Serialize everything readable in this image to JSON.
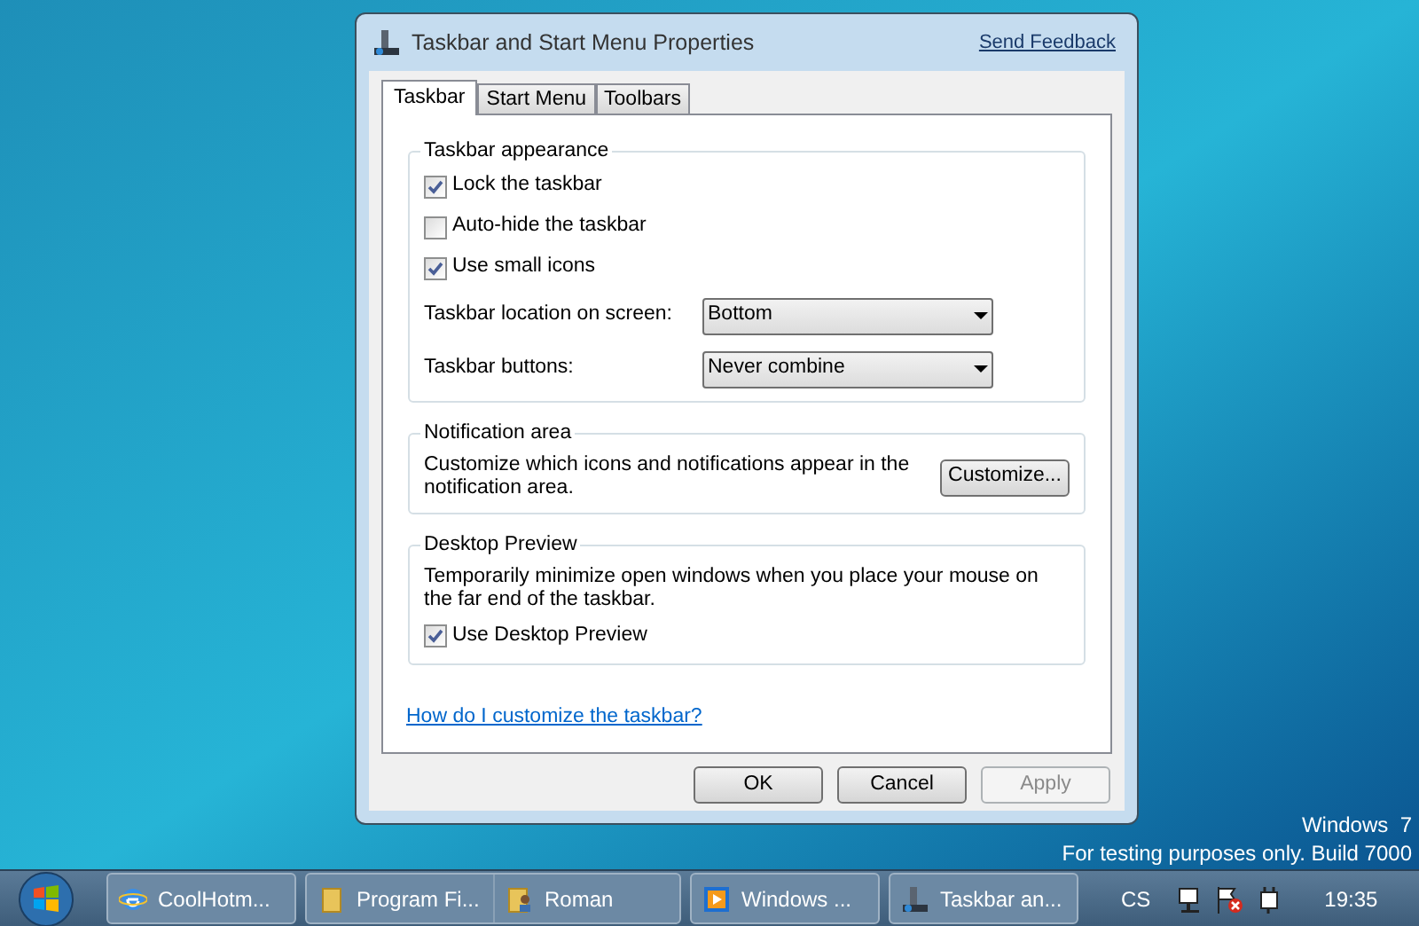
{
  "dialog": {
    "title": "Taskbar and Start Menu Properties",
    "feedback_link": "Send Feedback",
    "tabs": [
      {
        "label": "Taskbar",
        "selected": true
      },
      {
        "label": "Start Menu",
        "selected": false
      },
      {
        "label": "Toolbars",
        "selected": false
      }
    ],
    "appearance": {
      "title": "Taskbar appearance",
      "checkboxes": [
        {
          "label": "Lock the taskbar",
          "checked": true
        },
        {
          "label": "Auto-hide the taskbar",
          "checked": false
        },
        {
          "label": "Use small icons",
          "checked": true
        }
      ],
      "dropdowns": [
        {
          "label": "Taskbar location on screen:",
          "value": "Bottom"
        },
        {
          "label": "Taskbar buttons:",
          "value": "Never combine"
        }
      ]
    },
    "notification": {
      "title": "Notification area",
      "text": "Customize which icons and notifications appear in the notification area.",
      "button": "Customize..."
    },
    "preview": {
      "title": "Desktop Preview",
      "text": "Temporarily minimize open windows when you place your mouse on the far end of the taskbar.",
      "checkbox": {
        "label": "Use Desktop Preview",
        "checked": true
      }
    },
    "help_link": "How do I customize the taskbar?",
    "buttons": [
      {
        "label": "OK",
        "disabled": false
      },
      {
        "label": "Cancel",
        "disabled": false
      },
      {
        "label": "Apply",
        "disabled": true
      }
    ]
  },
  "desktop_text": [
    "Windows  7",
    "For testing purposes only. Build 7000"
  ],
  "taskbar": {
    "buttons": [
      {
        "items": [
          {
            "kind": "browser",
            "label": "CoolHotm..."
          }
        ]
      },
      {
        "items": [
          {
            "kind": "folder",
            "label": "Program Fi..."
          },
          {
            "kind": "user-folder",
            "label": "Roman"
          }
        ]
      },
      {
        "items": [
          {
            "kind": "media",
            "label": "Windows ..."
          }
        ]
      },
      {
        "items": [
          {
            "kind": "settings",
            "label": "Taskbar an..."
          }
        ]
      }
    ],
    "language": "CS",
    "clock": "19:35"
  }
}
